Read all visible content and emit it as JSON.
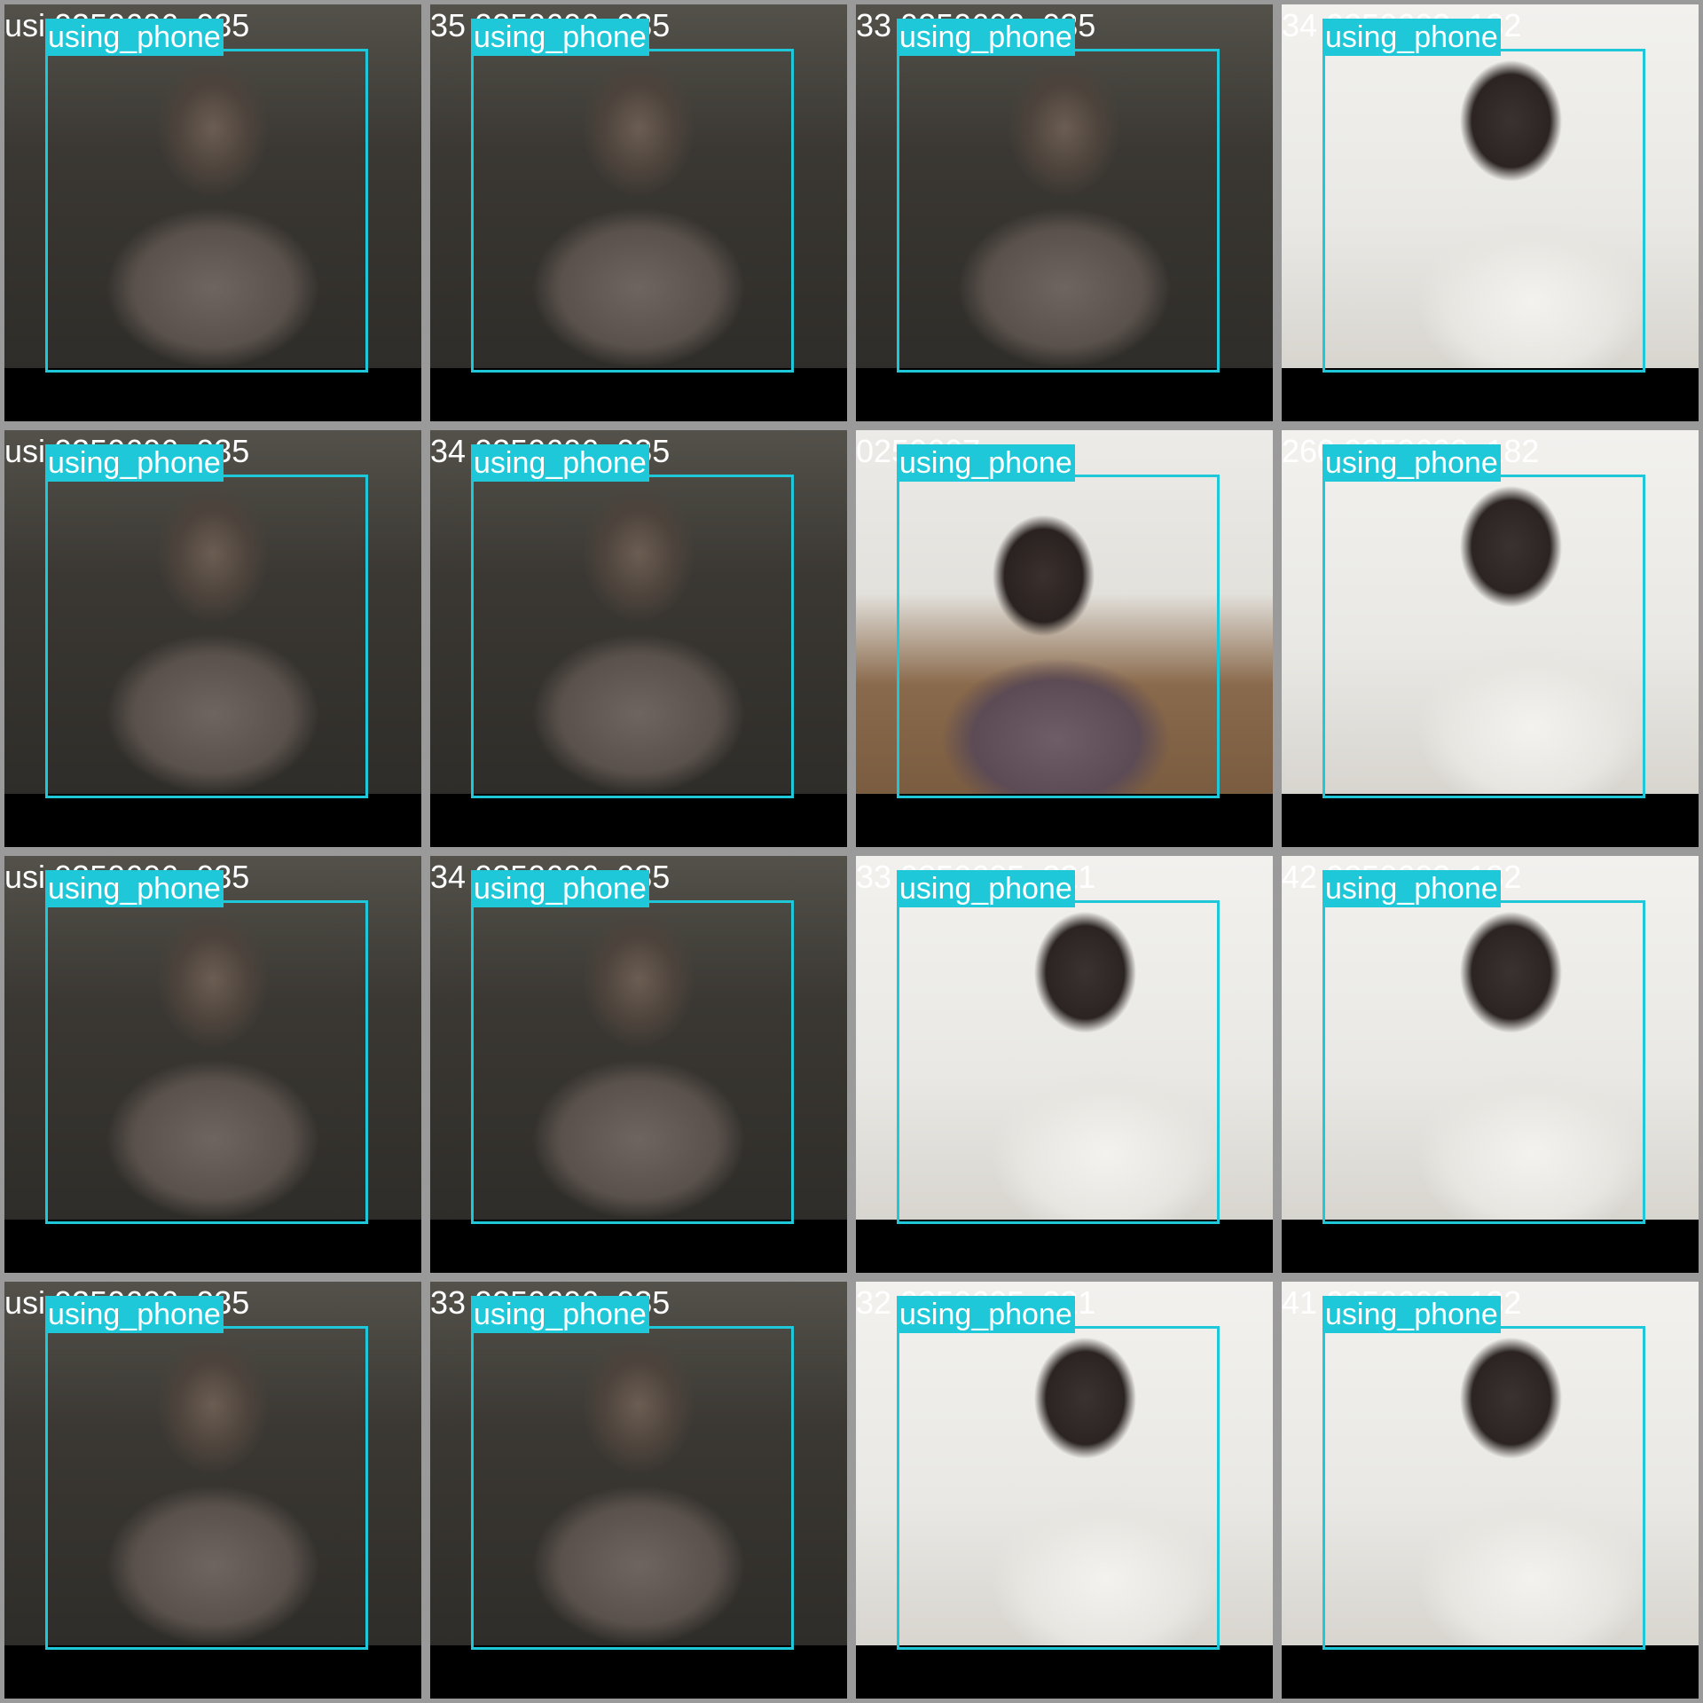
{
  "colors": {
    "box": "#1ec8d8",
    "label_bg": "#1ec8d8",
    "label_text": "#ffffff",
    "filename_text": "#ffffff",
    "grid_gap": "#9a9a9a"
  },
  "tiles": [
    {
      "filename": "usi          0250606_035",
      "label": "using_phone",
      "scene": "dark"
    },
    {
      "filename": "35            0250606_035",
      "label": "using_phone",
      "scene": "dark"
    },
    {
      "filename": "33            0250606_035",
      "label": "using_phone",
      "scene": "dark"
    },
    {
      "filename": "34            0250603_182",
      "label": "using_phone",
      "scene": "bright"
    },
    {
      "filename": "usi          0250606_035",
      "label": "using_phone",
      "scene": "dark"
    },
    {
      "filename": "34            0250606_035",
      "label": "using_phone",
      "scene": "dark"
    },
    {
      "filename": "               0250607_",
      "label": "using_phone",
      "scene": "sofa"
    },
    {
      "filename": "260           0250603_182",
      "label": "using_phone",
      "scene": "bright"
    },
    {
      "filename": "usi          0250606_035",
      "label": "using_phone",
      "scene": "dark"
    },
    {
      "filename": "34            0250606_035",
      "label": "using_phone",
      "scene": "dark"
    },
    {
      "filename": "33            0250605_221",
      "label": "using_phone",
      "scene": "bright"
    },
    {
      "filename": "42            0250603_182",
      "label": "using_phone",
      "scene": "bright"
    },
    {
      "filename": "usi          0250606_035",
      "label": "using_phone",
      "scene": "dark"
    },
    {
      "filename": "33            0250606_035",
      "label": "using_phone",
      "scene": "dark"
    },
    {
      "filename": "32            0250605_221",
      "label": "using_phone",
      "scene": "bright"
    },
    {
      "filename": "41            0250603_182",
      "label": "using_phone",
      "scene": "bright"
    }
  ]
}
